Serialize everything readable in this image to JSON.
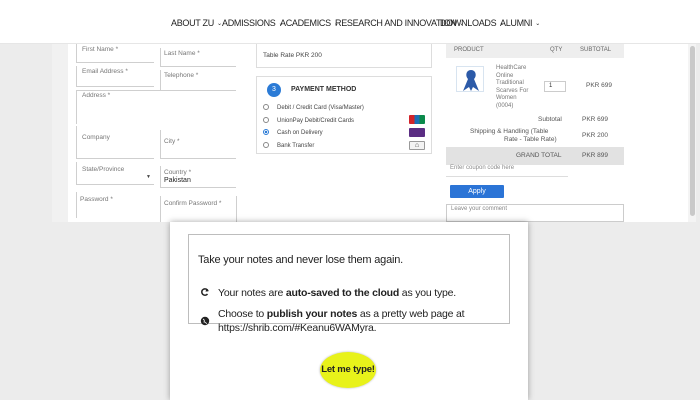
{
  "nav": {
    "items": [
      {
        "label": "ABOUT ZU"
      },
      {
        "label": "ADMISSIONS"
      },
      {
        "label": "ACADEMICS"
      },
      {
        "label": "RESEARCH AND INNOVATION"
      },
      {
        "label": "DOWNLOADS"
      },
      {
        "label": "ALUMNI"
      }
    ],
    "chevron": "⌄"
  },
  "billing": {
    "first_name": "First Name *",
    "last_name": "Last Name *",
    "email": "Email Address *",
    "telephone": "Telephone *",
    "address": "Address *",
    "company": "Company",
    "city": "City *",
    "state": "State/Province",
    "country_label": "Country *",
    "country_value": "Pakistan",
    "password": "Password *",
    "confirm_password": "Confirm Password *"
  },
  "shipping": {
    "rate_text": "Table Rate PKR 200"
  },
  "payment": {
    "step": "3",
    "title": "PAYMENT METHOD",
    "options": [
      {
        "label": "Debit / Credit Card (Visa/Master)",
        "selected": false
      },
      {
        "label": "UnionPay Debit/Credit Cards",
        "selected": false
      },
      {
        "label": "Cash on Delivery",
        "selected": true
      },
      {
        "label": "Bank Transfer",
        "selected": false
      }
    ]
  },
  "order": {
    "headers": {
      "product": "PRODUCT",
      "qty": "QTY",
      "subtotal": "SUBTOTAL"
    },
    "item": {
      "name_lines": [
        "HealthCare",
        "Online",
        "Traditional",
        "Scarves For",
        "Women",
        "(0004)"
      ],
      "qty": "1",
      "price": "PKR 699"
    },
    "subtotal_label": "Subtotal",
    "subtotal_value": "PKR 699",
    "shipping_label_1": "Shipping & Handling (Table",
    "shipping_label_2": "Rate - Table Rate)",
    "shipping_value": "PKR 200",
    "grand_label": "GRAND TOTAL",
    "grand_value": "PKR 899"
  },
  "coupon": {
    "placeholder": "Enter coupon code here",
    "apply": "Apply"
  },
  "comment": {
    "placeholder": "Leave your comment"
  },
  "promo": {
    "tagline": "Take your notes and never lose them again.",
    "bullet1_a": "Your notes are ",
    "bullet1_b": "auto-saved to the cloud",
    "bullet1_c": " as you type.",
    "bullet2_a": "Choose to ",
    "bullet2_b": "publish your notes",
    "bullet2_c": " as a pretty web page at",
    "bullet2_url": "https://shrib.com/#Keanu6WAMyra.",
    "cta": "Let me type!"
  },
  "colors": {
    "accent": "#2b74d6",
    "cta": "#e8f21a"
  }
}
